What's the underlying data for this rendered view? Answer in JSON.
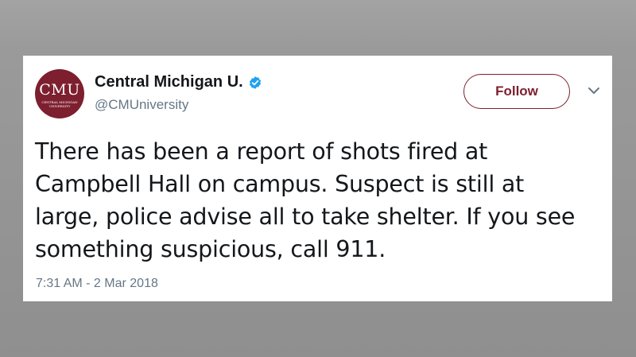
{
  "account": {
    "avatar_text": "CMU",
    "avatar_subtext": "CENTRAL MICHIGAN UNIVERSITY",
    "display_name": "Central Michigan U.",
    "handle": "@CMUniversity",
    "verified": true,
    "verified_icon": "verified-badge-icon"
  },
  "actions": {
    "follow_label": "Follow",
    "more_icon": "chevron-down-icon"
  },
  "tweet": {
    "text": "There has been a report of shots fired at Campbell Hall on campus. Suspect is still at large, police advise all to take shelter. If you see something suspicious, call 911.",
    "timestamp": "7:31 AM - 2 Mar 2018"
  },
  "colors": {
    "brand": "#7d1f2e",
    "verified": "#1da1f2",
    "secondary_text": "#657786",
    "background": "#8d8d8d"
  }
}
